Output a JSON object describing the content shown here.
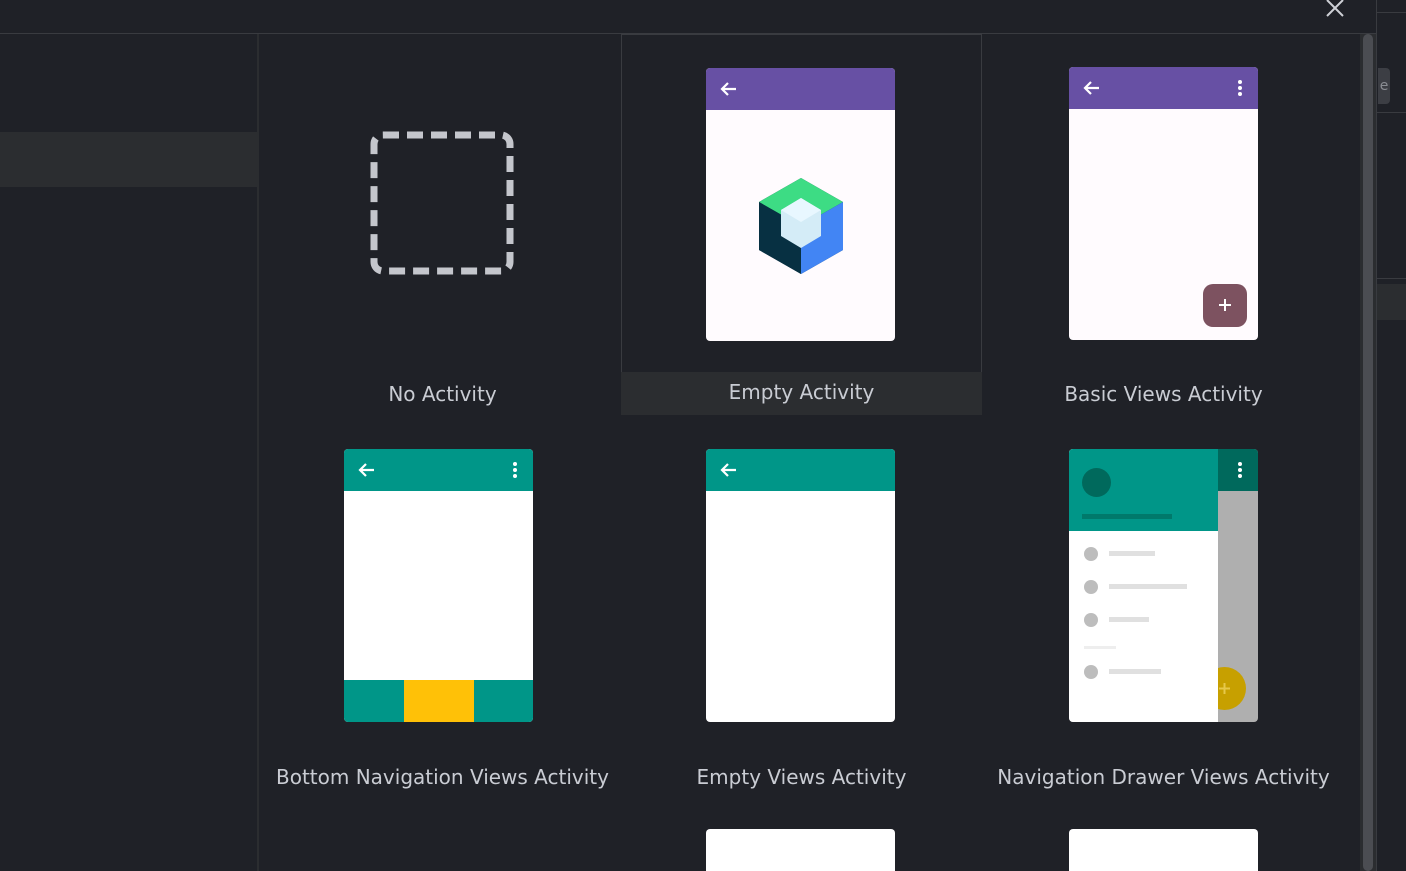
{
  "dialog": {
    "close_icon": "close-icon"
  },
  "templates": [
    {
      "label": "No Activity"
    },
    {
      "label": "Empty Activity"
    },
    {
      "label": "Basic Views Activity"
    },
    {
      "label": "Bottom Navigation Views Activity"
    },
    {
      "label": "Empty Views Activity"
    },
    {
      "label": "Navigation Drawer Views Activity"
    }
  ],
  "right_edge": {
    "partial_label": "e"
  },
  "colors": {
    "background": "#1f2127",
    "selected_tile": "#2b2d30",
    "material_purple": "#6750a4",
    "teal": "#009688",
    "fab_maroon": "#7d5260",
    "bottom_nav_yellow": "#ffc107"
  }
}
